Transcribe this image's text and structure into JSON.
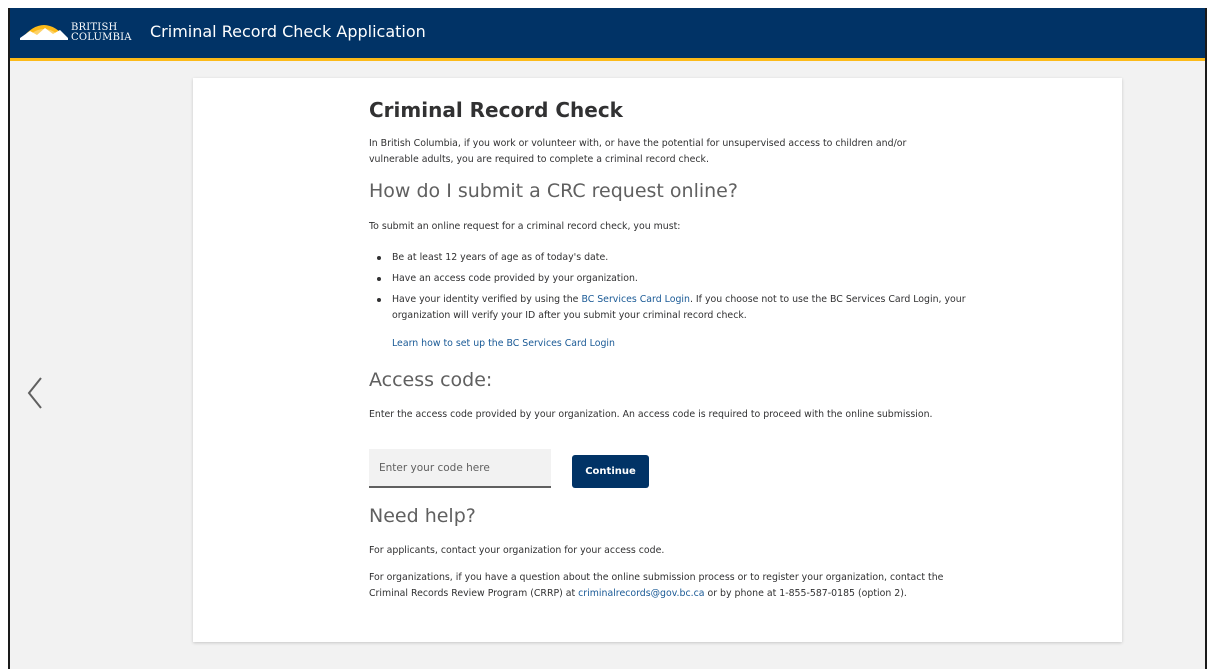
{
  "header": {
    "logo_line1": "BRITISH",
    "logo_line2": "COLUMBIA",
    "app_title": "Criminal Record Check Application"
  },
  "nav": {
    "left_icon": "chevron-left-icon"
  },
  "main": {
    "title": "Criminal Record Check",
    "intro": "In British Columbia, if you work or volunteer with, or have the potential for unsupervised access to children and/or vulnerable adults, you are required to complete a criminal record check.",
    "submit_heading": "How do I submit a CRC request online?",
    "submit_intro": "To submit an online request for a criminal record check, you must:",
    "requirements": [
      "Be at least 12 years of age as of today's date.",
      "Have an access code provided by your organization."
    ],
    "identity": {
      "before": "Have your identity verified by using the ",
      "link": "BC Services Card Login",
      "after": ". If you choose not to use the BC Services Card Login, your organization will verify your ID after you submit your criminal record check."
    },
    "setup_link": "Learn how to set up the BC Services Card Login",
    "access_heading": "Access code:",
    "access_desc": "Enter the access code provided by your organization. An access code is required to proceed with the online submission.",
    "code_placeholder": "Enter your code here",
    "continue_label": "Continue",
    "help_heading": "Need help?",
    "help_applicants": "For applicants, contact your organization for your access code.",
    "help_orgs": {
      "before": "For organizations, if you have a question about the online submission process or to register your organization, contact the Criminal Records Review Program (CRRP) at ",
      "email": "criminalrecords@gov.bc.ca",
      "after": " or by phone at 1-855-587-0185 (option 2)."
    }
  },
  "colors": {
    "header_bg": "#013366",
    "accent_gold": "#fcba19",
    "link": "#1a5a96",
    "page_bg": "#f2f2f2"
  }
}
